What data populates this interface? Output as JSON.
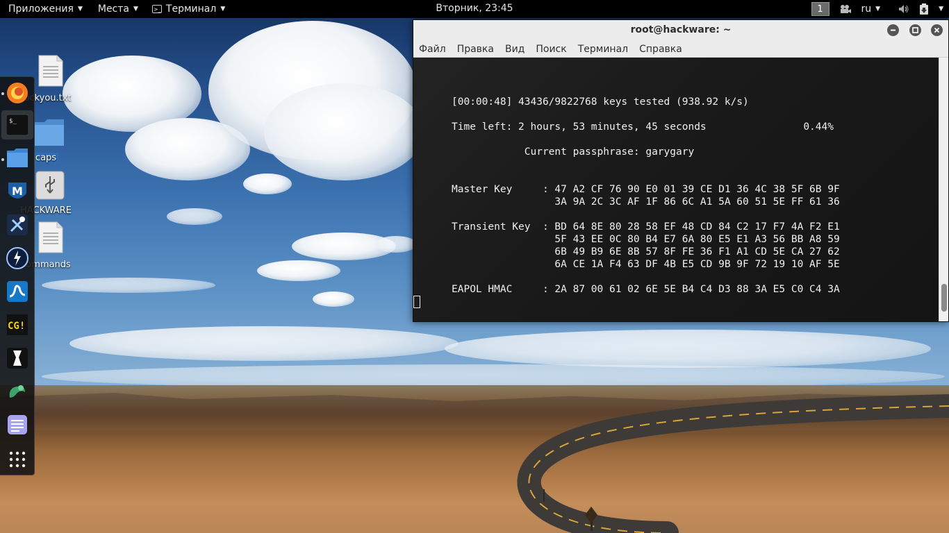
{
  "top_panel": {
    "applications": "Приложения",
    "places": "Места",
    "terminal_app": "Терминал",
    "clock": "Вторник, 23:45",
    "workspace": "1",
    "keyboard_layout": "ru"
  },
  "desktop_icons": [
    {
      "label": "rockyou.txt",
      "icon": "text-file-icon"
    },
    {
      "label": "caps",
      "icon": "folder-icon"
    },
    {
      "label": "HACKWARE",
      "icon": "usb-drive-icon"
    },
    {
      "label": "commands",
      "icon": "text-file-icon"
    }
  ],
  "dock": {
    "items": [
      "firefox-icon",
      "terminal-icon",
      "files-icon",
      "metasploit-icon",
      "armitage-icon",
      "burpsuite-icon",
      "wireshark-icon",
      "cherrytree-icon",
      "maltego-icon",
      "zaproxy-icon",
      "text-editor-icon",
      "show-apps-icon"
    ]
  },
  "terminal": {
    "title": "root@hackware: ~",
    "menu": [
      "Файл",
      "Правка",
      "Вид",
      "Поиск",
      "Терминал",
      "Справка"
    ],
    "lines": {
      "keys_tested": "[00:00:48] 43436/9822768 keys tested (938.92 k/s)",
      "time_left": "Time left: 2 hours, 53 minutes, 45 seconds                0.44%",
      "passphrase": "            Current passphrase: garygary",
      "master_key_1": "Master Key     : 47 A2 CF 76 90 E0 01 39 CE D1 36 4C 38 5F 6B 9F",
      "master_key_2": "                 3A 9A 2C 3C AF 1F 86 6C A1 5A 60 51 5E FF 61 36",
      "transient_key_1": "Transient Key  : BD 64 8E 80 28 58 EF 48 CD 84 C2 17 F7 4A F2 E1",
      "transient_key_2": "                 5F 43 EE 0C 80 B4 E7 6A 80 E5 E1 A3 56 BB A8 59",
      "transient_key_3": "                 6B 49 B9 6E 8B 57 8F FE 36 F1 A1 CD 5E CA 27 62",
      "transient_key_4": "                 6A CE 1A F4 63 DF 4B E5 CD 9B 9F 72 19 10 AF 5E",
      "eapol_hmac": "EAPOL HMAC     : 2A 87 00 61 02 6E 5E B4 C4 D3 88 3A E5 C0 C4 3A"
    }
  }
}
